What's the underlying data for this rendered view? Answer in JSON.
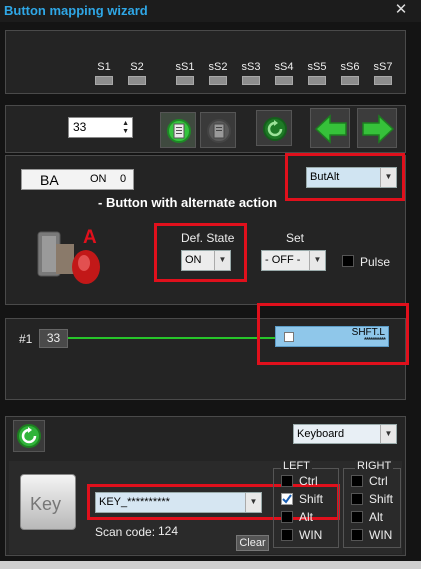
{
  "window": {
    "title": "Button mapping wizard",
    "close_glyph": "✕"
  },
  "shift_slots": [
    "S1",
    "S2",
    "sS1",
    "sS2",
    "sS3",
    "sS4",
    "sS5",
    "sS6",
    "sS7"
  ],
  "toolbar": {
    "button_number": "33"
  },
  "button": {
    "name": "BA",
    "state": "ON",
    "value": "0",
    "type": "ButAlt",
    "type_description": "- Button with alternate action",
    "image_letter": "A",
    "def_state_label": "Def. State",
    "def_state_value": "ON",
    "set_label": "Set",
    "set_value": "- OFF -",
    "pulse_label": "Pulse"
  },
  "mapping": {
    "index_label": "#1",
    "number": "33",
    "target_label": "SHFT.L",
    "target_value": "**********"
  },
  "output": {
    "device": "Keyboard",
    "key_icon_label": "Key",
    "key_value": "KEY_**********",
    "scan_code_label": "Scan code:",
    "scan_code_value": "124",
    "clear_label": "Clear",
    "left_label": "LEFT",
    "right_label": "RIGHT",
    "left_mods": [
      "Ctrl",
      "Shift",
      "Alt",
      "WIN"
    ],
    "right_mods": [
      "Ctrl",
      "Shift",
      "Alt",
      "WIN"
    ],
    "shift_checked": true
  },
  "colors": {
    "accent": "#2fa7e6",
    "highlight": "#e0101c",
    "mapping_line": "#27c52a",
    "green": "#2ebd2e"
  }
}
